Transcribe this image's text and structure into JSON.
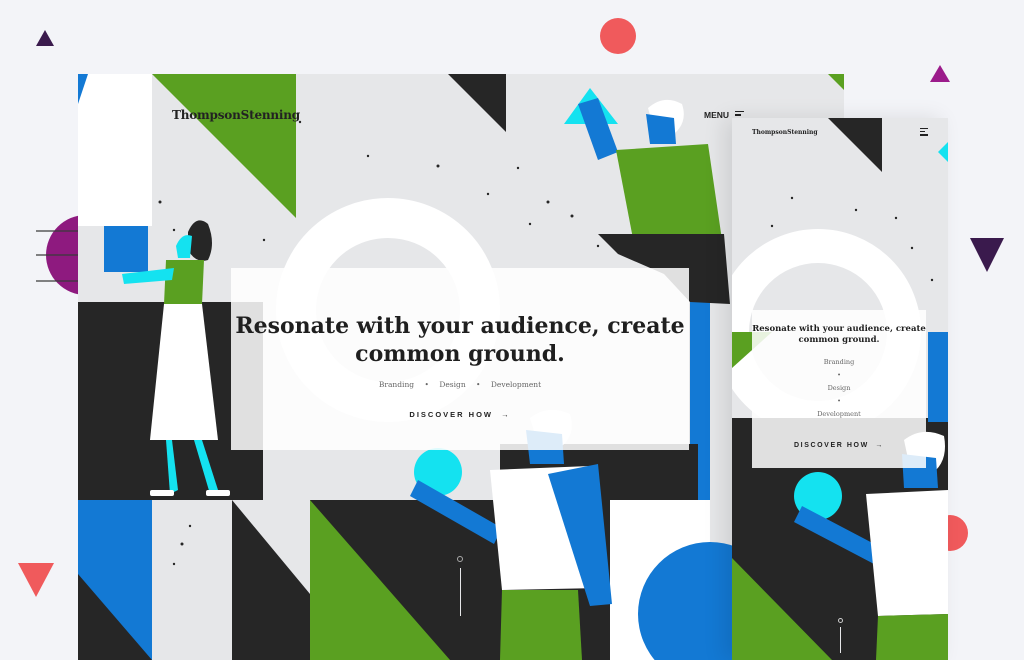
{
  "desktop": {
    "brand": "ThompsonStenning",
    "menu_label": "MENU",
    "hero": {
      "headline_line1": "Resonate with your audience, create",
      "headline_line2": "common ground.",
      "tags": [
        "Branding",
        "Design",
        "Development"
      ],
      "cta_label": "DISCOVER HOW"
    }
  },
  "mobile": {
    "brand": "ThompsonStenning",
    "hero": {
      "headline_line1": "Resonate with your audience, create",
      "headline_line2": "common ground.",
      "tags": [
        "Branding",
        "Design",
        "Development"
      ],
      "cta_label": "DISCOVER HOW"
    }
  },
  "icons": {
    "menu": "hamburger-icon",
    "arrow": "arrow-right-icon",
    "scroll": "scroll-indicator-icon"
  },
  "colors": {
    "green": "#5aa021",
    "blue": "#1379d4",
    "cyan": "#14e2f0",
    "dark": "#262626",
    "coral": "#f05a5c",
    "purple": "#8e1a7f",
    "navy": "#3a1a4d"
  }
}
